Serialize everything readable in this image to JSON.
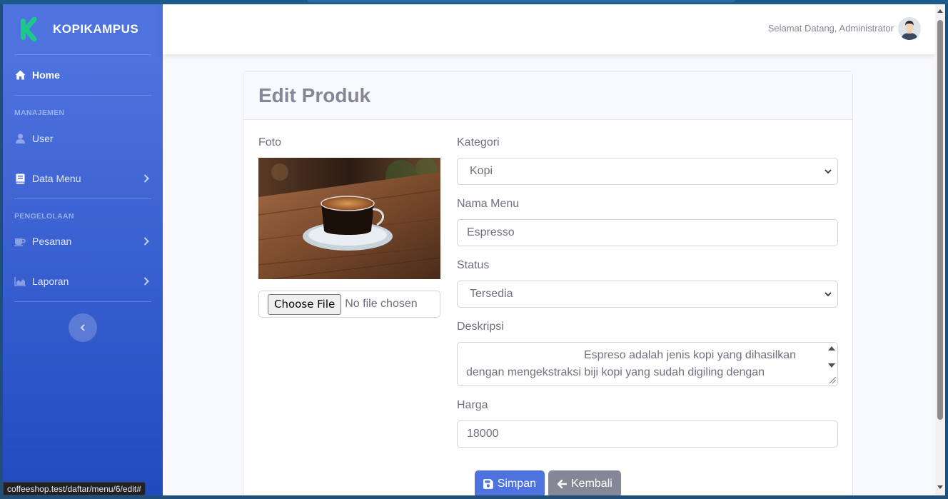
{
  "brand": {
    "name": "KOPIKAMPUS",
    "logo_color": "#1cc88a"
  },
  "sidebar": {
    "home": "Home",
    "heading_manajemen": "MANAJEMEN",
    "user": "User",
    "data_menu": "Data Menu",
    "heading_pengelolaan": "PENGELOLAAN",
    "pesanan": "Pesanan",
    "laporan": "Laporan"
  },
  "topbar": {
    "welcome": "Selamat Datang, Administrator"
  },
  "page": {
    "title": "Edit Produk"
  },
  "form": {
    "foto_label": "Foto",
    "file_button": "Choose File",
    "file_status": "No file chosen",
    "kategori_label": "Kategori",
    "kategori_value": "Kopi",
    "nama_label": "Nama Menu",
    "nama_value": "Espresso",
    "status_label": "Status",
    "status_value": "Tersedia",
    "deskripsi_label": "Deskripsi",
    "deskripsi_value": "Espreso adalah jenis kopi yang dihasilkan dengan mengekstraksi biji kopi yang sudah digiling dengan",
    "harga_label": "Harga",
    "harga_value": "18000",
    "save_button": "Simpan",
    "back_button": "Kembali"
  },
  "status_url": "coffeeshop.test/daftar/menu/6/edit#",
  "colors": {
    "primary": "#4e73df",
    "secondary": "#858796",
    "sidebar_dark": "#224abe"
  }
}
